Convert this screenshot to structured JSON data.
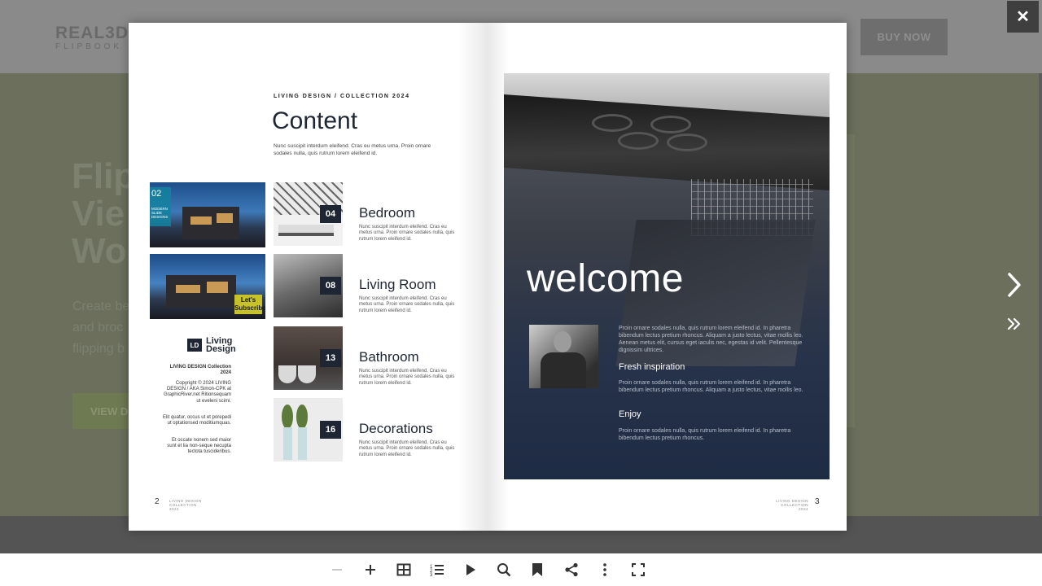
{
  "website": {
    "logo_line1": "REAL3D",
    "logo_line2": "FLIPBOOK",
    "buy_label": "BUY NOW",
    "hero_title": [
      "Flip",
      "Vie",
      "Wo"
    ],
    "hero_text": [
      "Create be",
      "and broc",
      "flipping b"
    ],
    "hero_button": "VIEW D"
  },
  "lightbox": {
    "close_icon": "close-icon",
    "next_icon": "chevron-right-icon",
    "last_icon": "double-chevron-right-icon"
  },
  "left_page": {
    "eyebrow": "LIVING DESIGN / COLLECTION 2024",
    "title": "Content",
    "intro": "Nunc suscipit interdum eleifend. Cras eu metus urna. Proin ornare sodales nulla, quis rutrum lorem eleifend id.",
    "thumb_a_number": "02",
    "thumb_a_caption": "MODERN SLIDE DESIGNS",
    "thumb_b_badge": "Let's Subscribe",
    "toc": [
      {
        "num": "04",
        "name": "Bedroom",
        "desc": "Nunc suscipit interdum eleifend. Cras eu metus urna. Proin ornare sodales nulla, quis rutrum lorem eleifend id."
      },
      {
        "num": "08",
        "name": "Living Room",
        "desc": "Nunc suscipit interdum eleifend. Cras eu metus urna. Proin ornare sodales nulla, quis rutrum lorem eleifend id."
      },
      {
        "num": "13",
        "name": "Bathroom",
        "desc": "Nunc suscipit interdum eleifend. Cras eu metus urna. Proin ornare sodales nulla, quis rutrum lorem eleifend id."
      },
      {
        "num": "16",
        "name": "Decorations",
        "desc": "Nunc suscipit interdum eleifend. Cras eu metus urna. Proin ornare sodales nulla, quis rutrum lorem eleifend id."
      }
    ],
    "brand_mark": "LD",
    "brand_name_1": "Living",
    "brand_name_2": "Design",
    "collection": "LIVING DESIGN Collection 2024",
    "copyright": "Copyright © 2024 LIVING DESIGN / AKA Simon-CPK at GraphicRiver.net Ritionsequam ut eveleni scimi.",
    "elit": "Elit quatur, occus ut et porepedi ut optationsed moditiumquas.",
    "et": "Et occate nonem sed maior sunt et lia non-seque necupta tectota tuscideribus.",
    "folio": "2",
    "folio_small": "LIVING DESIGN COLLECTION 2024"
  },
  "right_page": {
    "welcome": "welcome",
    "para1": "Proin ornare sodales nulla, quis rutrum lorem eleifend id. In pharetra bibendum lectus pretium rhoncus. Aliquam a justo lectus, vitae mollis leo. Aenean metus elit, cursus eget iaculis nec, egestas id velit. Pellentesque dignissim ultrices.",
    "heading1": "Fresh inspiration",
    "para2": "Proin ornare sodales nulla, quis rutrum lorem eleifend id. In pharetra bibendum lectus pretium rhoncus. Aliquam a justo lectus, vitae mollis leo.",
    "heading2": "Enjoy",
    "para3": "Proin ornare sodales nulla, quis rutrum lorem eleifend id. In pharetra bibendum lectus pretium rhoncus.",
    "folio": "3",
    "folio_small": "LIVING DESIGN COLLECTION 2024"
  },
  "toolbar": {
    "tools": [
      "zoom-out-icon",
      "zoom-in-icon",
      "thumbnails-icon",
      "table-of-contents-icon",
      "autoplay-icon",
      "search-icon",
      "bookmark-icon",
      "share-icon",
      "more-icon",
      "fullscreen-icon"
    ]
  }
}
